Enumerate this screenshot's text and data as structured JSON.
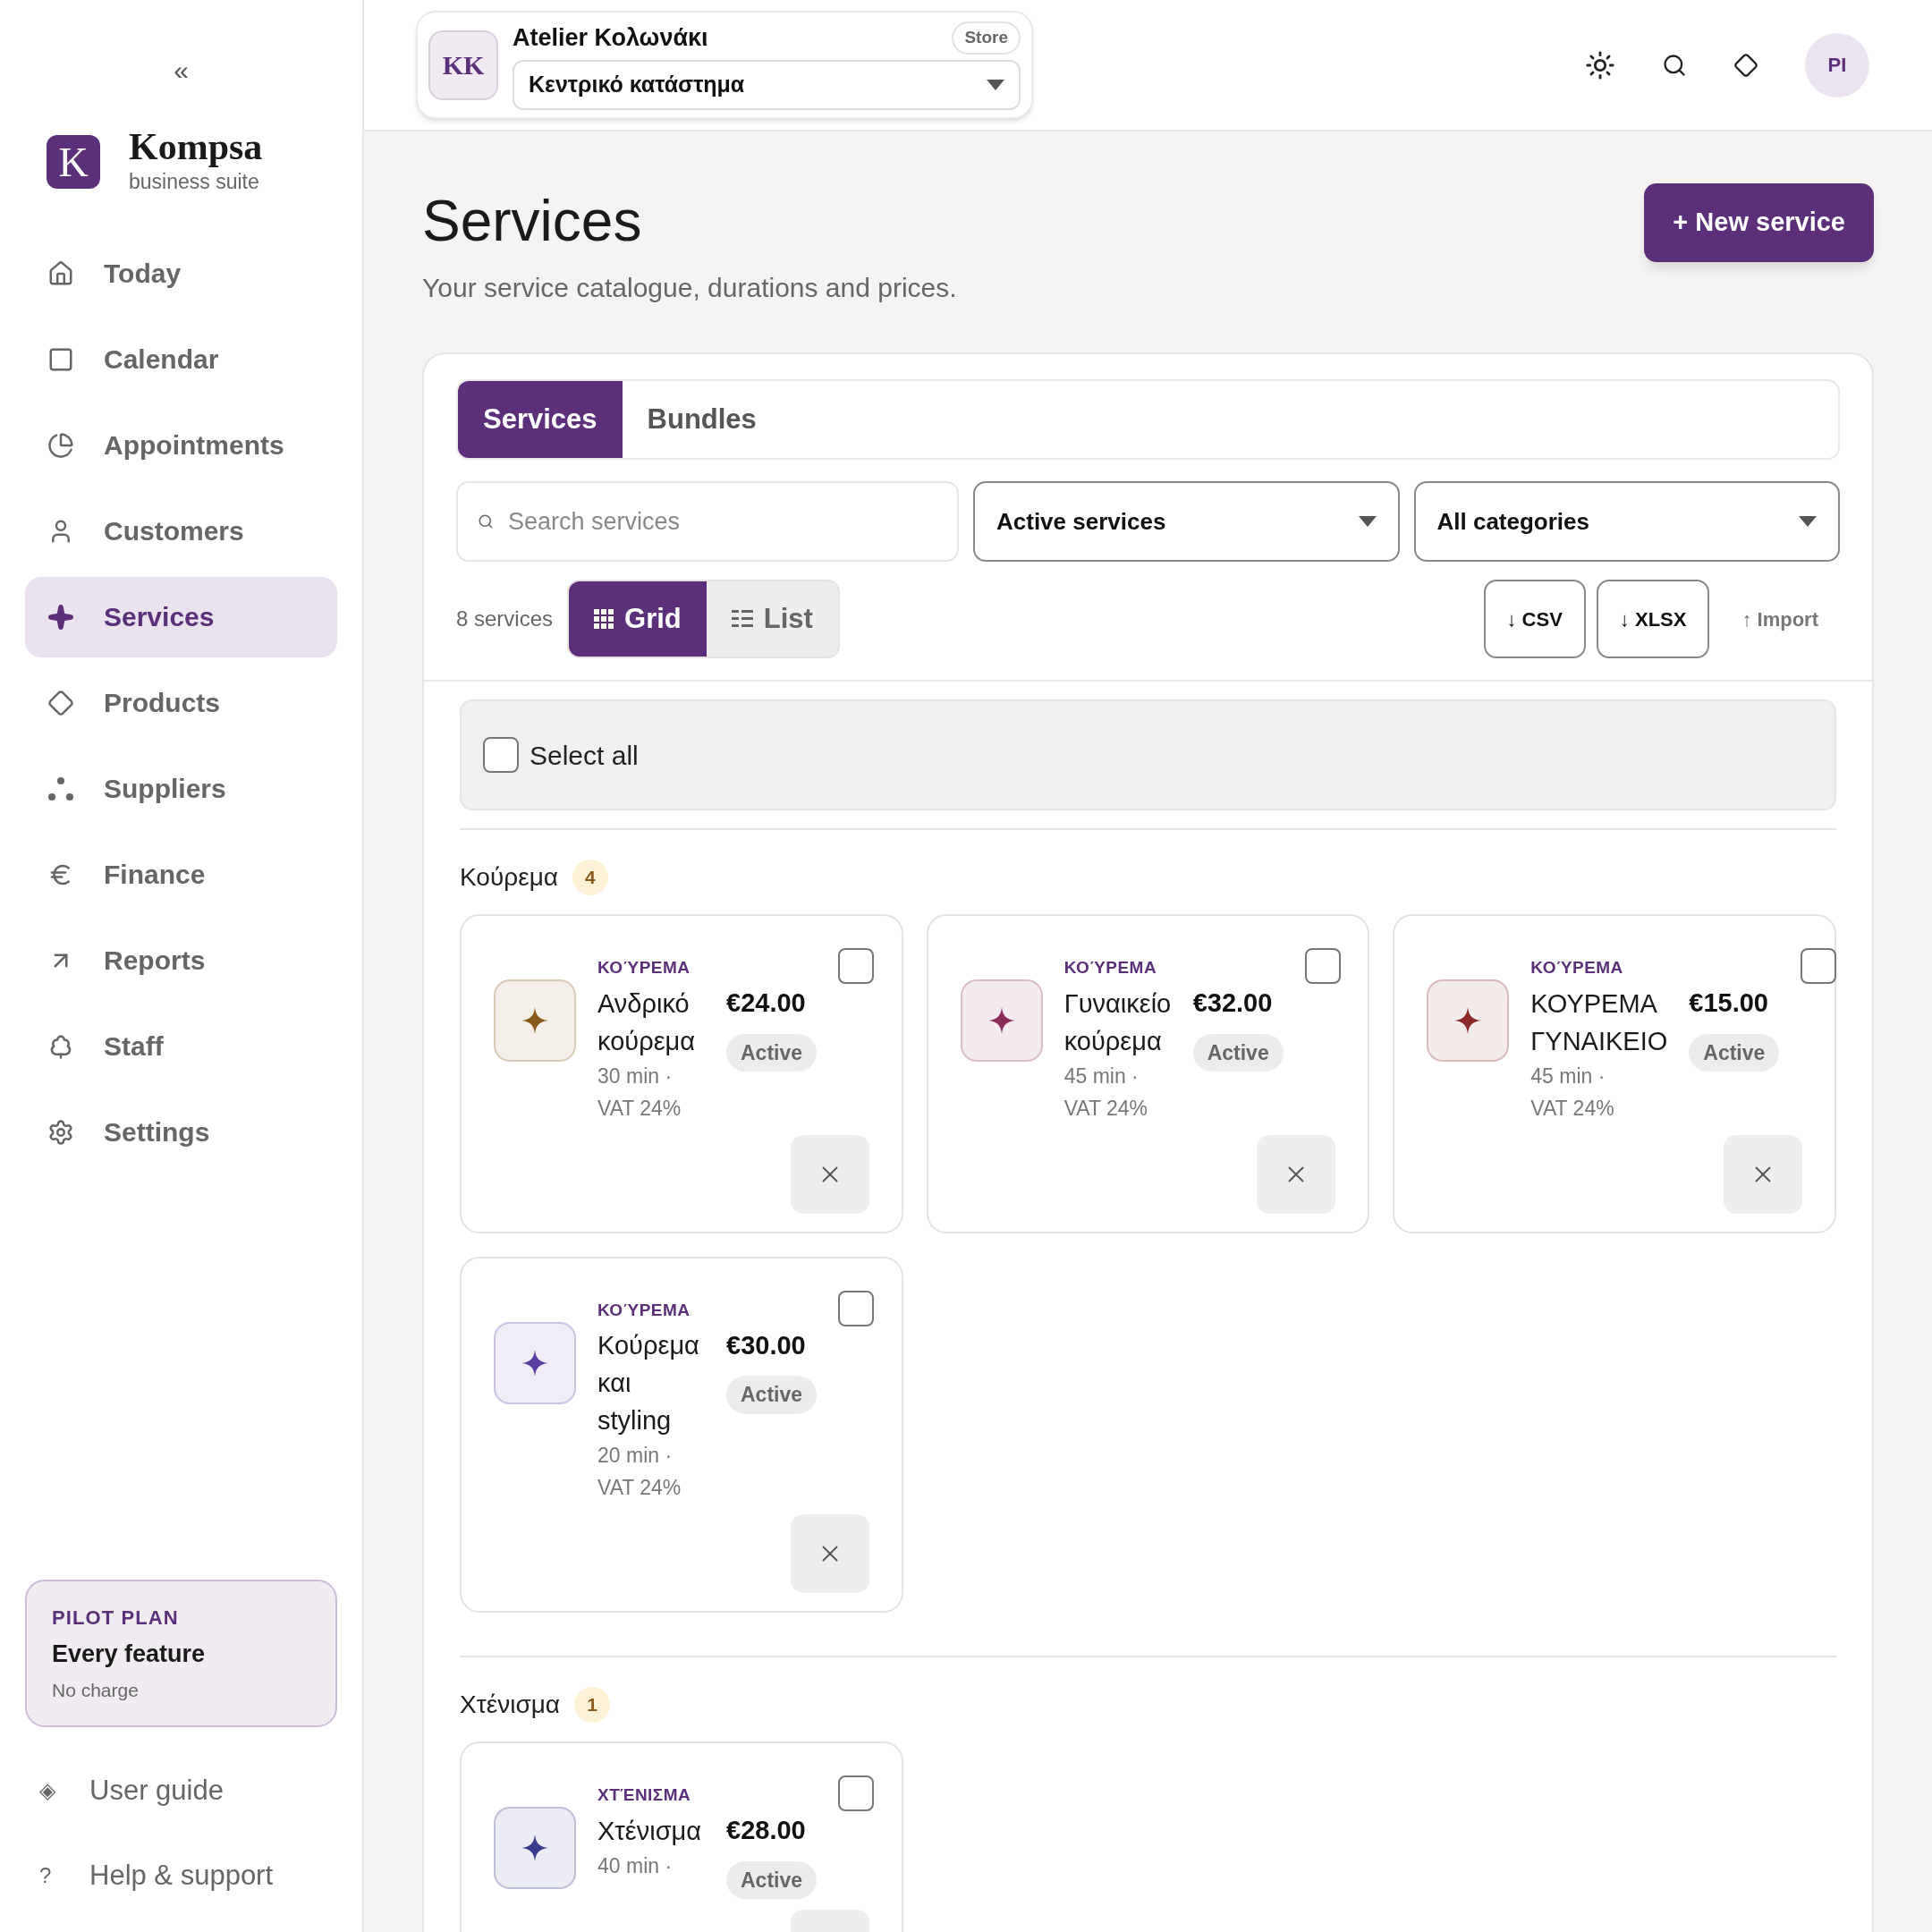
{
  "sidebar": {
    "collapse": "«",
    "brand": {
      "initial": "K",
      "name": "Kompsa",
      "tagline": "business suite"
    },
    "items": [
      {
        "label": "Today",
        "selected": false
      },
      {
        "label": "Calendar",
        "selected": false
      },
      {
        "label": "Appointments",
        "selected": false
      },
      {
        "label": "Customers",
        "selected": false
      },
      {
        "label": "Services",
        "selected": true
      },
      {
        "label": "Products",
        "selected": false
      },
      {
        "label": "Suppliers",
        "selected": false
      },
      {
        "label": "Finance",
        "selected": false
      },
      {
        "label": "Reports",
        "selected": false
      },
      {
        "label": "Staff",
        "selected": false
      },
      {
        "label": "Settings",
        "selected": false
      }
    ],
    "plan": {
      "eyebrow": "PILOT PLAN",
      "title": "Every feature",
      "note": "No charge"
    },
    "footer_links": [
      {
        "icon": "◈",
        "label": "User guide"
      },
      {
        "icon": "?",
        "label": "Help & support"
      }
    ]
  },
  "header": {
    "workspace": {
      "initials": "KK",
      "name": "Atelier Κολωνάκι",
      "badge": "Store",
      "location": "Κεντρικό κατάστημα"
    },
    "avatar": "PI"
  },
  "page": {
    "title": "Services",
    "subtitle": "Your service catalogue, durations and prices.",
    "primary_button": "+ New service"
  },
  "tabs": [
    {
      "label": "Services",
      "selected": true
    },
    {
      "label": "Bundles",
      "selected": false
    }
  ],
  "filters": {
    "search": {
      "placeholder": "Search services"
    },
    "status": "Active services",
    "category": "All categories"
  },
  "toolbar": {
    "count": "8 services",
    "views": [
      {
        "label": "Grid",
        "selected": true
      },
      {
        "label": "List",
        "selected": false
      }
    ],
    "actions": [
      {
        "label": "↓ CSV",
        "kind": "outlined"
      },
      {
        "label": "↓ XLSX",
        "kind": "outlined"
      },
      {
        "label": "↑ Import",
        "kind": "plain"
      }
    ]
  },
  "select_all": {
    "label": "Select all",
    "checked": false
  },
  "groups": [
    {
      "name": "Κούρεμα",
      "count": "4",
      "services": [
        {
          "category": "ΚΟΎΡΕΜΑ",
          "name": "Ανδρικό κούρεμα",
          "meta": "30 min · VAT 24%",
          "price": "€24.00",
          "status": "Active",
          "color": "#8a5a1a",
          "checked": false
        },
        {
          "category": "ΚΟΎΡΕΜΑ",
          "name": "Γυναικείο κούρεμα",
          "meta": "45 min · VAT 24%",
          "price": "€32.00",
          "status": "Active",
          "color": "#8c2e5c",
          "checked": false
        },
        {
          "category": "ΚΟΎΡΕΜΑ",
          "name": "ΚΟΥΡΕΜΑ ΓΥΝΑΙΚΕΙΟ",
          "meta": "45 min · VAT 24%",
          "price": "€15.00",
          "status": "Active",
          "color": "#8c2a2a",
          "checked": false
        },
        {
          "category": "ΚΟΎΡΕΜΑ",
          "name": "Κούρεμα και styling",
          "meta": "20 min · VAT 24%",
          "price": "€30.00",
          "status": "Active",
          "color": "#5b3fa0",
          "checked": false
        }
      ]
    },
    {
      "name": "Χτένισμα",
      "count": "1",
      "services": [
        {
          "category": "ΧΤΈΝΙΣΜΑ",
          "name": "Χτένισμα",
          "meta": "40 min ·",
          "price": "€28.00",
          "status": "Active",
          "color": "#3a3a8a",
          "checked": false
        }
      ]
    }
  ]
}
